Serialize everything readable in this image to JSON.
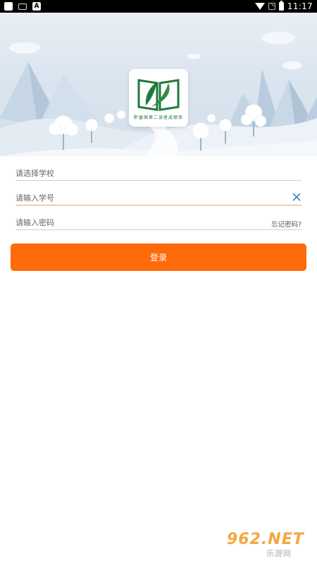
{
  "status_bar": {
    "time": "11:17",
    "left_icons": [
      "app-icon",
      "keyboard-icon",
      "a-icon"
    ],
    "right_icons": [
      "wifi-icon",
      "no-signal-icon",
      "battery-icon"
    ]
  },
  "header": {
    "logo": {
      "caption": "黔番图第二读者成绩单",
      "icon": "open-book-leaf-logo",
      "color": "#1f7a3a"
    }
  },
  "form": {
    "school": {
      "placeholder": "请选择学校",
      "value": ""
    },
    "student_id": {
      "placeholder": "请输入学号",
      "value": "",
      "clear_icon": "close-icon"
    },
    "password": {
      "placeholder": "请输入密码",
      "value": "",
      "forgot_label": "忘记密码?"
    }
  },
  "login_button": {
    "label": "登录",
    "color": "#ff6a0a"
  },
  "watermark": {
    "text": "962.NET",
    "sub": "乐游网"
  }
}
